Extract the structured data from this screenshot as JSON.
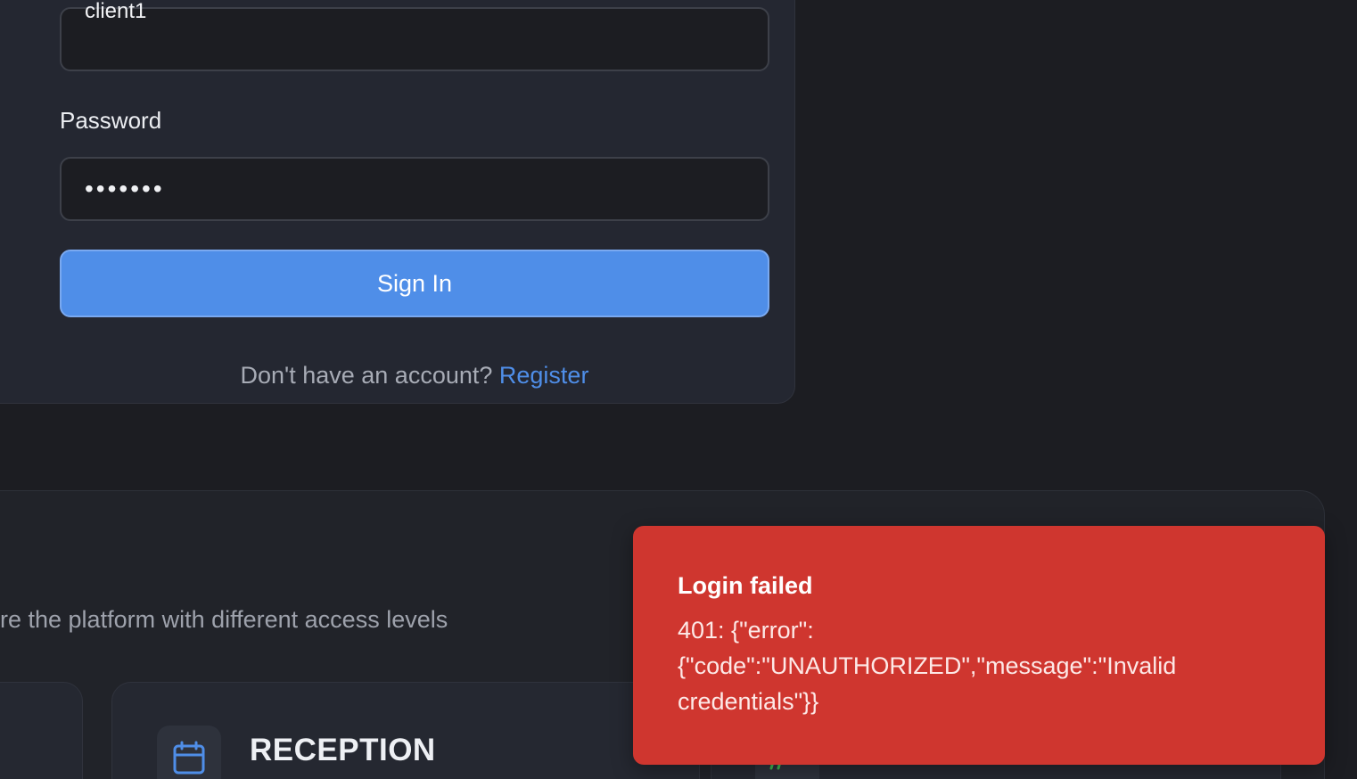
{
  "login": {
    "username_value": "client1",
    "password_label": "Password",
    "password_value": "•••••••",
    "signin_label": "Sign In",
    "register_prompt": "Don't have an account?",
    "register_link": "Register"
  },
  "roles": {
    "subtitle": "re the platform with different access levels",
    "card_title": "RECEPTION",
    "card_icon": "calendar-icon"
  },
  "toast": {
    "title": "Login failed",
    "message": "401: {\"error\":{\"code\":\"UNAUTHORIZED\",\"message\":\"Invalid credentials\"}}"
  },
  "colors": {
    "background": "#1c1d22",
    "card": "#242731",
    "accent": "#4f8ee8",
    "error": "#cf362f"
  }
}
